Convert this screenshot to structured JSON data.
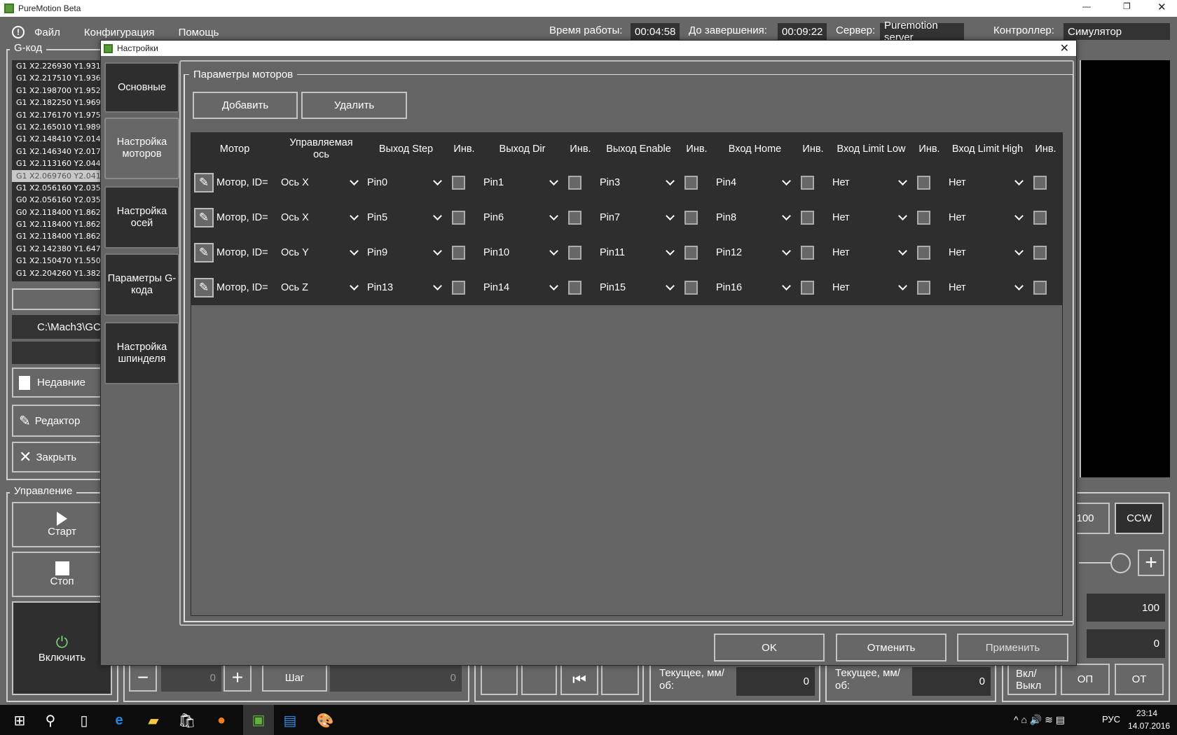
{
  "window": {
    "title": "PureMotion Beta"
  },
  "menu": {
    "items": [
      "Файл",
      "Конфигурация",
      "Помощь"
    ]
  },
  "status": {
    "uptime_label": "Время работы:",
    "uptime": "00:04:58",
    "remaining_label": "До завершения:",
    "remaining": "00:09:22",
    "server_label": "Сервер:",
    "server": "Puremotion server",
    "controller_label": "Контроллер:",
    "controller": "Симулятор"
  },
  "gcode": {
    "title": "G-код",
    "lines": [
      "G1 X2.226930 Y1.931",
      "G1 X2.217510 Y1.936",
      "G1 X2.198700 Y1.952",
      "G1 X2.182250 Y1.969",
      "G1 X2.176170 Y1.975",
      "G1 X2.165010 Y1.989",
      "G1 X2.148410 Y2.014",
      "G1 X2.146340 Y2.017",
      "G1 X2.113160 Y2.044",
      "G1 X2.069760 Y2.041",
      "G1 X2.056160 Y2.035",
      "G0 X2.056160 Y2.035",
      "G0 X2.118400 Y1.862",
      "G1 X2.118400 Y1.862",
      "G1 X2.118400 Y1.862",
      "G1 X2.142380 Y1.647",
      "G1 X2.150470 Y1.550",
      "G1 X2.204260 Y1.382"
    ],
    "selected_index": 9,
    "file_path": "C:\\Mach3\\GC",
    "recent": "Недавние",
    "editor": "Редактор",
    "close": "Закрыть"
  },
  "control": {
    "title": "Управление",
    "start": "Старт",
    "stop": "Стоп",
    "power": "Включить",
    "power_color": "#7ed27e"
  },
  "bottom": {
    "jog_value": "0",
    "step_label": "Шаг",
    "step_value": "0",
    "current1_label": "Текущее, мм/об:",
    "current1_value": "0",
    "current2_label": "Текущее, мм/об:",
    "current2_value": "0",
    "onoff": "Вкл/ Выкл",
    "op": "ОП",
    "ot": "ОТ"
  },
  "spindle": {
    "speed_btn": "100",
    "dir_btn": "CCW",
    "value1": "100",
    "value2": "0"
  },
  "dialog": {
    "title": "Настройки",
    "tabs": [
      "Основные",
      "Настройка моторов",
      "Настройка осей",
      "Параметры G-кода",
      "Настройка шпинделя"
    ],
    "active_tab": 1,
    "group_title": "Параметры моторов",
    "add": "Добавить",
    "remove": "Удалить",
    "columns": [
      "Мотор",
      "Управляемая ось",
      "Выход Step",
      "Инв.",
      "Выход Dir",
      "Инв.",
      "Выход Enable",
      "Инв.",
      "Вход Home",
      "Инв.",
      "Вход Limit Low",
      "Инв.",
      "Вход Limit High",
      "Инв."
    ],
    "rows": [
      {
        "motor": "Мотор, ID=",
        "axis": "Ось X",
        "step": "Pin0",
        "step_inv": false,
        "dir": "Pin1",
        "dir_inv": false,
        "enable": "Pin3",
        "enable_inv": false,
        "home": "Pin4",
        "home_inv": false,
        "limit_low": "Нет",
        "limit_low_inv": false,
        "limit_high": "Нет",
        "limit_high_inv": false
      },
      {
        "motor": "Мотор, ID=",
        "axis": "Ось X",
        "step": "Pin5",
        "step_inv": false,
        "dir": "Pin6",
        "dir_inv": false,
        "enable": "Pin7",
        "enable_inv": false,
        "home": "Pin8",
        "home_inv": false,
        "limit_low": "Нет",
        "limit_low_inv": false,
        "limit_high": "Нет",
        "limit_high_inv": false
      },
      {
        "motor": "Мотор, ID=",
        "axis": "Ось Y",
        "step": "Pin9",
        "step_inv": false,
        "dir": "Pin10",
        "dir_inv": false,
        "enable": "Pin11",
        "enable_inv": false,
        "home": "Pin12",
        "home_inv": false,
        "limit_low": "Нет",
        "limit_low_inv": false,
        "limit_high": "Нет",
        "limit_high_inv": false
      },
      {
        "motor": "Мотор, ID=",
        "axis": "Ось Z",
        "step": "Pin13",
        "step_inv": false,
        "dir": "Pin14",
        "dir_inv": false,
        "enable": "Pin15",
        "enable_inv": false,
        "home": "Pin16",
        "home_inv": false,
        "limit_low": "Нет",
        "limit_low_inv": false,
        "limit_high": "Нет",
        "limit_high_inv": false
      }
    ],
    "ok": "OK",
    "cancel": "Отменить",
    "apply": "Применить"
  },
  "taskbar": {
    "lang": "РУС",
    "time": "23:14",
    "date": "14.07.2016"
  }
}
